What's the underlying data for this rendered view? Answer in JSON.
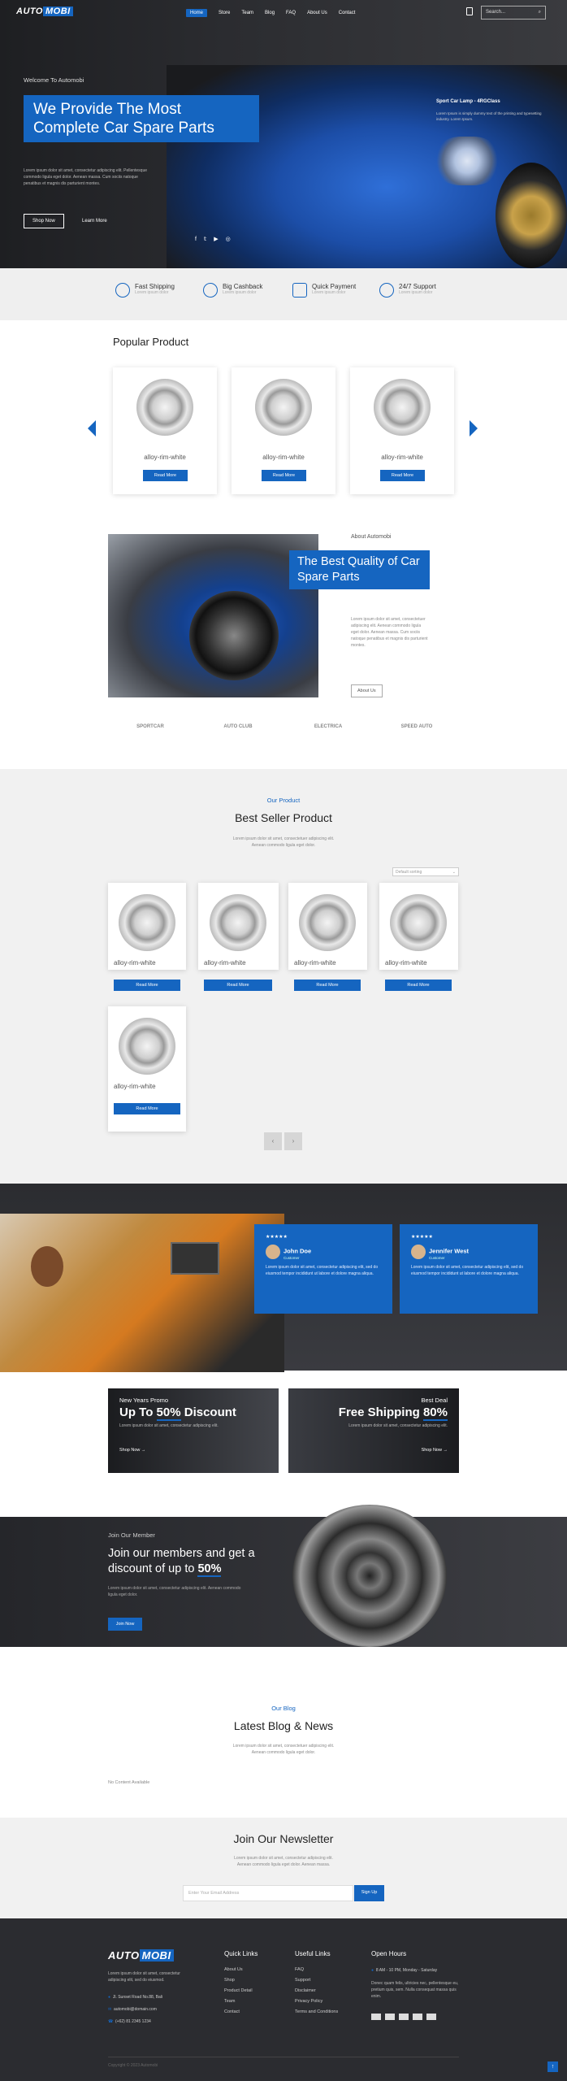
{
  "brand": {
    "logo_left": "AUTO",
    "logo_right": "MOBI"
  },
  "nav": {
    "items": [
      "Home",
      "Store",
      "Team",
      "Blog",
      "FAQ",
      "About Us",
      "Contact"
    ],
    "search_placeholder": "Search..."
  },
  "hero": {
    "welcome": "Welcome To Automobi",
    "headline": "We Provide The Most Complete Car Spare Parts",
    "body": "Lorem ipsum dolor sit amet, consectetur adipiscing elit. Pellentesque commodo ligula eget dolor. Aenean massa. Cum sociis natoque penatibus et magnis dis parturient montes.",
    "shop_now": "Shop Now",
    "learn_more": "Learn More",
    "product_title": "Sport Car Lamp - 4RGClass",
    "product_desc": "Lorem Ipsum is simply dummy text of the printing and typesetting industry. Lorem Ipsum."
  },
  "features": [
    {
      "title": "Fast Shipping",
      "sub": "Lorem ipsum dolor"
    },
    {
      "title": "Big Cashback",
      "sub": "Lorem ipsum dolor"
    },
    {
      "title": "Quick Payment",
      "sub": "Lorem ipsum dolor"
    },
    {
      "title": "24/7 Support",
      "sub": "Lorem ipsum dolor"
    }
  ],
  "popular": {
    "title": "Popular Product",
    "products": [
      {
        "name": "alloy-rim-white",
        "btn": "Read More"
      },
      {
        "name": "alloy-rim-white",
        "btn": "Read More"
      },
      {
        "name": "alloy-rim-white",
        "btn": "Read More"
      }
    ]
  },
  "about": {
    "label": "About Automobi",
    "headline": "The Best Quality of Car Spare Parts",
    "body": "Lorem ipsum dolor sit amet, consectetuer adipiscing elit. Aenean commodo ligula eget dolor. Aenean massa. Cum sociis natoque penatibus et magnis dis parturient montes.",
    "btn": "About Us"
  },
  "brands": [
    "SPORTCAR",
    "AUTO CLUB",
    "ELECTRICA",
    "SPEED AUTO"
  ],
  "best": {
    "label": "Our Product",
    "title": "Best Seller Product",
    "desc": "Lorem ipsum dolor sit amet, consectetuer adipiscing elit. Aenean commodo ligula eget dolor.",
    "sort": "Default sorting",
    "products": [
      {
        "name": "alloy-rim-white",
        "btn": "Read More"
      },
      {
        "name": "alloy-rim-white",
        "btn": "Read More"
      },
      {
        "name": "alloy-rim-white",
        "btn": "Read More"
      },
      {
        "name": "alloy-rim-white",
        "btn": "Read More"
      },
      {
        "name": "alloy-rim-white",
        "btn": "Read More"
      }
    ]
  },
  "testimonials": [
    {
      "stars": "★★★★★",
      "name": "John Doe",
      "role": "Customer",
      "text": "Lorem ipsum dolor sit amet, consectetur adipiscing elit, sed do eiusmod tempor incididunt ut labore et dolore magna aliqua."
    },
    {
      "stars": "★★★★★",
      "name": "Jennifer West",
      "role": "Customer",
      "text": "Lorem ipsum dolor sit amet, consectetur adipiscing elit, sed do eiusmod tempor incididunt ut labore et dolore magna aliqua."
    }
  ],
  "promos": [
    {
      "kicker": "New Years Promo",
      "title_a": "Up To ",
      "title_b": "50%",
      "title_c": " Discount",
      "desc": "Lorem ipsum dolor sit amet, consectetur adipiscing elit.",
      "btn": "Shop Now"
    },
    {
      "kicker": "Best Deal",
      "title_a": "Free Shipping ",
      "title_b": "80%",
      "title_c": "",
      "desc": "Lorem ipsum dolor sit amet, consectetur adipiscing elit.",
      "btn": "Shop Now"
    }
  ],
  "join": {
    "label": "Join Our Member",
    "title_a": "Join our members and get a discount of up to ",
    "title_b": "50%",
    "desc": "Lorem ipsum dolor sit amet, consectetur adipiscing elit. Aenean commodo ligula eget dolor.",
    "btn": "Join Now"
  },
  "blog": {
    "label": "Our Blog",
    "title": "Latest Blog & News",
    "desc": "Lorem ipsum dolor sit amet, consectetuer adipiscing elit. Aenean commodo ligula eget dolor.",
    "empty": "No Content Available"
  },
  "newsletter": {
    "title": "Join Our Newsletter",
    "desc": "Lorem ipsum dolor sit amet, consectetur adipiscing elit. Aenean commodo ligula eget dolor. Aenean massa.",
    "placeholder": "Enter Your Email Address",
    "btn": "Sign Up"
  },
  "footer": {
    "about": "Lorem ipsum dolor sit amet, consectetur adipiscing elit, sed do eiusmod.",
    "address": "Jl. Sunset Road No.88, Bali",
    "email": "automobi@domain.com",
    "phone": "(+62) 81 2345 1234",
    "quick_title": "Quick Links",
    "quick": [
      "About Us",
      "Shop",
      "Product Detail",
      "Team",
      "Contact"
    ],
    "useful_title": "Useful Links",
    "useful": [
      "FAQ",
      "Support",
      "Disclaimer",
      "Privacy Policy",
      "Terms and Conditions"
    ],
    "hours_title": "Open Hours",
    "hours": "8 AM - 10 PM, Monday - Saturday",
    "hours_desc": "Donec quam felis, ultricies nec, pellentesque eu, pretium quis, sem. Nulla consequat massa quis enim.",
    "copyright": "Copyright © 2023 Automobi"
  },
  "colors": {
    "accent": "#1565c0",
    "dark": "#2b2c30"
  }
}
